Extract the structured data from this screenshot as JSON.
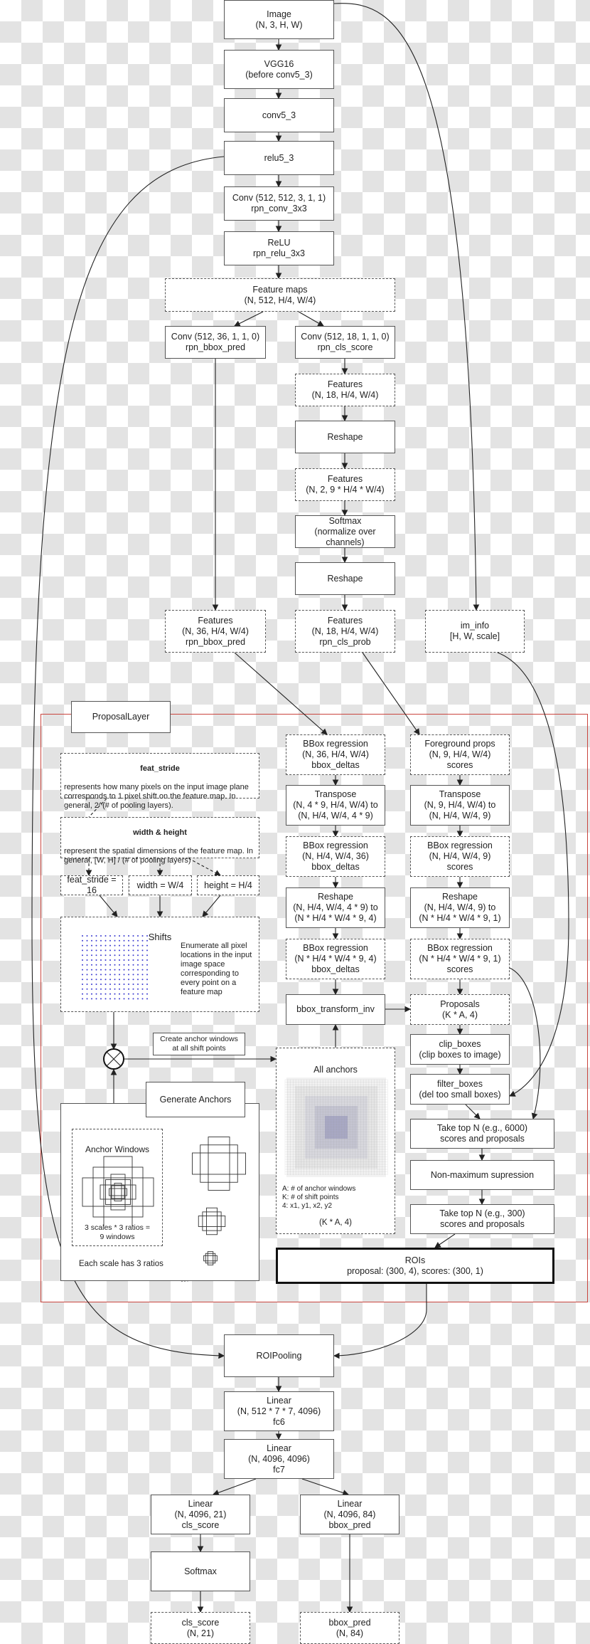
{
  "nodes": {
    "image": "Image\n(N, 3, H, W)",
    "vgg16": "VGG16\n(before conv5_3)",
    "conv5_3": "conv5_3",
    "relu5_3": "relu5_3",
    "rpn_conv": "Conv (512, 512, 3, 1, 1)\nrpn_conv_3x3",
    "rpn_relu": "ReLU\nrpn_relu_3x3",
    "feature_maps": "Feature maps\n(N, 512, H/4, W/4)",
    "conv_bbox": "Conv (512, 36, 1, 1, 0)\nrpn_bbox_pred",
    "conv_cls": "Conv (512, 18, 1, 1, 0)\nrpn_cls_score",
    "features_18": "Features\n(N, 18, H/4, W/4)",
    "reshape_1": "Reshape",
    "features_2": "Features\n(N, 2, 9 * H/4 * W/4)",
    "softmax_rpn": "Softmax\n(normalize over\nchannels)",
    "reshape_2": "Reshape",
    "features_bbox_pred": "Features\n(N, 36, H/4, W/4)\nrpn_bbox_pred",
    "features_cls_prob": "Features\n(N, 18, H/4, W/4)\nrpn_cls_prob",
    "im_info": "im_info\n[H, W, scale]",
    "proposal_layer": "ProposalLayer",
    "bbox_reg_1": "BBox regression\n(N, 36, H/4, W/4)\nbbox_deltas",
    "fg_props": "Foreground props\n(N, 9, H/4, W/4)\nscores",
    "transpose_bbox": "Transpose\n(N, 4 * 9, H/4, W/4) to\n(N, H/4, W/4, 4 * 9)",
    "transpose_scores": "Transpose\n(N, 9, H/4, W/4) to\n(N, H/4, W/4, 9)",
    "bbox_reg_2": "BBox regression\n(N, H/4, W/4, 36)\nbbox_deltas",
    "scores_2": "BBox regression\n(N, H/4, W/4, 9)\nscores",
    "reshape_bbox": "Reshape\n(N, H/4, W/4, 4 * 9) to\n(N * H/4 * W/4 * 9, 4)",
    "reshape_scores": "Reshape\n(N, H/4, W/4, 9) to\n(N * H/4 * W/4 * 9, 1)",
    "bbox_reg_3": "BBox regression\n(N * H/4 * W/4 * 9, 4)\nbbox_deltas",
    "scores_3": "BBox regression\n(N * H/4 * W/4 * 9, 1)\nscores",
    "bbox_transform_inv": "bbox_transform_inv",
    "proposals": "Proposals\n(K * A, 4)",
    "clip_boxes": "clip_boxes\n(clip boxes to image)",
    "filter_boxes": "filter_boxes\n(del too small boxes)",
    "top_n_6000": "Take top N (e.g., 6000)\nscores and proposals",
    "nms": "Non-maximum supression",
    "top_n_300": "Take top N (e.g., 300)\nscores and proposals",
    "rois": "ROIs\nproposal: (300, 4), scores: (300, 1)",
    "feat_stride_eq": "feat_stride = 16",
    "width_eq": "width = W/4",
    "height_eq": "height = H/4",
    "create_anchor": "Create anchor windows\nat all shift points",
    "generate_anchors": "Generate Anchors",
    "roi_pooling": "ROIPooling",
    "fc6": "Linear\n(N, 512 * 7 * 7, 4096)\nfc6",
    "fc7": "Linear\n(N, 4096, 4096)\nfc7",
    "cls_linear": "Linear\n(N, 4096, 21)\ncls_score",
    "bbox_linear": "Linear\n(N, 4096, 84)\nbbox_pred",
    "softmax_cls": "Softmax",
    "cls_score_out": "cls_score\n(N, 21)",
    "bbox_pred_out": "bbox_pred\n(N, 84)"
  },
  "notes": {
    "feat_stride_title": "feat_stride",
    "feat_stride_text": "represents how many pixels on the input image plane corresponds to 1 pixel shift on the feature map. In general, 2^(# of pooling layers).",
    "wh_title": "width & height",
    "wh_text": "represent the spatial dimensions of the feature map. In general, [W, H] / (# of pooling layers)",
    "shifts_title": "Shifts",
    "shifts_text": "Enumerate all pixel locations in the input image space corresponding to every point on a feature map",
    "all_anchors_title": "All anchors",
    "all_anchors_legend": "A: # of anchor windows\nK: # of shift points\n4: x1, y1, x2, y2",
    "all_anchors_shape": "(K * A, 4)",
    "anchor_windows_title": "Anchor Windows",
    "anchor_windows_text": "3 scales * 3 ratios =\n9 windows",
    "each_scale": "Each scale has 3 ratios"
  },
  "colors": {
    "proposal_frame": "#c9453e",
    "shift_dots": "#3a3ad0",
    "edge": "#222222"
  }
}
